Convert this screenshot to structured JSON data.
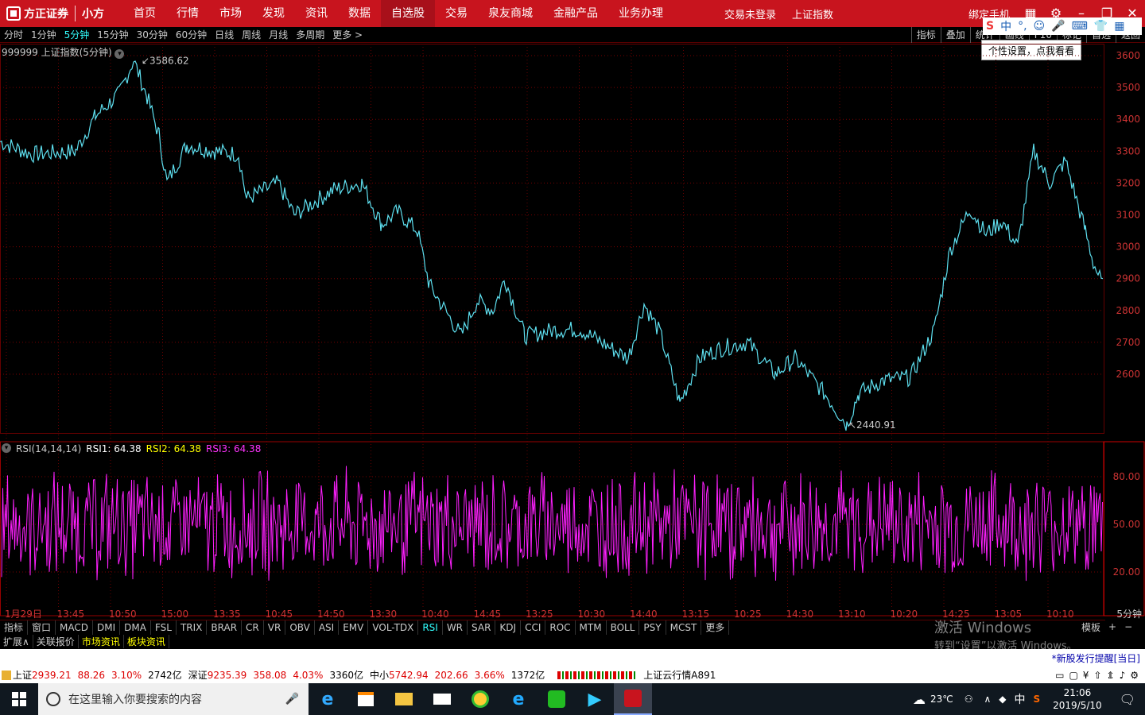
{
  "nav": {
    "brand": "方正证券",
    "brand_sub": "小方",
    "items": [
      "首页",
      "行情",
      "市场",
      "发现",
      "资讯",
      "数据",
      "自选股",
      "交易",
      "泉友商城",
      "金融产品",
      "业务办理"
    ],
    "active_index": 6,
    "status_login": "交易未登录",
    "status_index": "上证指数",
    "bind_phone": "绑定手机"
  },
  "periods": {
    "items": [
      "分时",
      "1分钟",
      "5分钟",
      "15分钟",
      "30分钟",
      "60分钟",
      "日线",
      "周线",
      "月线",
      "多周期",
      "更多 >"
    ],
    "active_index": 2,
    "tools": [
      "指标",
      "叠加",
      "统计",
      "画线",
      "F10",
      "标记",
      "自选",
      "返回"
    ]
  },
  "ime": {
    "label": "中"
  },
  "tip": "个性设置，点我看看",
  "chart": {
    "title": "999999 上证指数(5分钟)",
    "high_label": "3586.62",
    "low_label": "2440.91",
    "price_ticks": [
      "3600",
      "3500",
      "3400",
      "3300",
      "3200",
      "3100",
      "3000",
      "2900",
      "2800",
      "2700",
      "2600"
    ],
    "price_color": "#5ee0f0"
  },
  "rsi": {
    "name": "RSI(14,14,14)",
    "rsi1": "RSI1: 64.38",
    "rsi2": "RSI2: 64.38",
    "rsi3": "RSI3: 64.38",
    "ticks": [
      "80.00",
      "50.00",
      "20.00"
    ],
    "color": "#ff20ff"
  },
  "time_axis": [
    "1月29日",
    "13:45",
    "10:50",
    "15:00",
    "13:35",
    "10:45",
    "14:50",
    "13:30",
    "10:40",
    "14:45",
    "13:25",
    "10:30",
    "14:40",
    "13:15",
    "10:25",
    "14:30",
    "13:10",
    "10:20",
    "14:25",
    "13:05",
    "10:10"
  ],
  "period_label": "5分钟",
  "indicator_tabs": {
    "items": [
      "指标",
      "窗口",
      "MACD",
      "DMI",
      "DMA",
      "FSL",
      "TRIX",
      "BRAR",
      "CR",
      "VR",
      "OBV",
      "ASI",
      "EMV",
      "VOL-TDX",
      "RSI",
      "WR",
      "SAR",
      "KDJ",
      "CCI",
      "ROC",
      "MTM",
      "BOLL",
      "PSY",
      "MCST",
      "更多"
    ],
    "active_index": 14,
    "template": "模板"
  },
  "ext_tabs": {
    "items": [
      "扩展∧",
      "关联报价",
      "市场资讯",
      "板块资讯"
    ]
  },
  "watermark": {
    "line1": "激活 Windows",
    "line2": "转到“设置”以激活 Windows。"
  },
  "news": "*新股发行提醒[当日]",
  "quotes": {
    "sh_label": "上证",
    "sh_price": "2939.21",
    "sh_change": "88.26",
    "sh_pct": "3.10%",
    "sh_vol": "2742亿",
    "sz_label": "深证",
    "sz_price": "9235.39",
    "sz_change": "358.08",
    "sz_pct": "4.03%",
    "sz_vol": "3360亿",
    "zx_label": "中小",
    "zx_price": "5742.94",
    "zx_change": "202.66",
    "zx_pct": "3.66%",
    "zx_vol": "1372亿",
    "cloud": "上证云行情A891"
  },
  "taskbar": {
    "search_placeholder": "在这里输入你要搜索的内容",
    "weather": "23℃",
    "ime": "中",
    "time": "21:06",
    "date": "2019/5/10"
  }
}
